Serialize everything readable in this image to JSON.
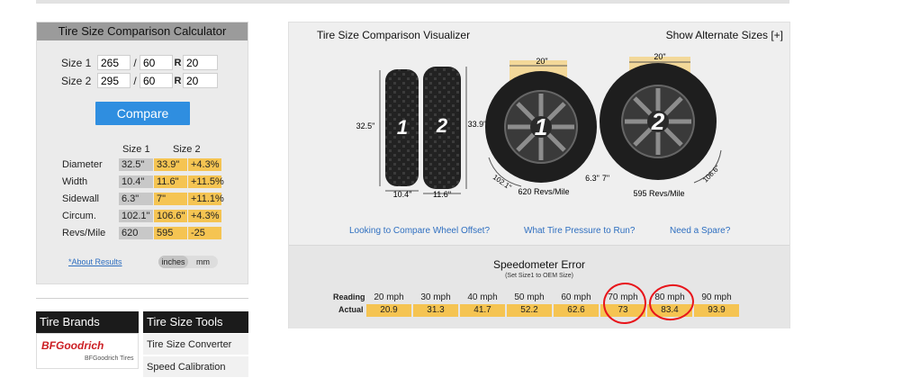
{
  "calculator": {
    "title": "Tire Size Comparison Calculator",
    "size1": {
      "label": "Size 1",
      "width": "265",
      "ratio": "60",
      "rim": "20"
    },
    "size2": {
      "label": "Size 2",
      "width": "295",
      "ratio": "60",
      "rim": "20"
    },
    "slash": "/",
    "rim_prefix": "R",
    "compare_label": "Compare",
    "col_size1": "Size 1",
    "col_size2": "Size 2",
    "rows": [
      {
        "label": "Diameter",
        "s1": "32.5\"",
        "s2": "33.9\"",
        "diff": "+4.3%"
      },
      {
        "label": "Width",
        "s1": "10.4\"",
        "s2": "11.6\"",
        "diff": "+11.5%"
      },
      {
        "label": "Sidewall",
        "s1": "6.3\"",
        "s2": "7\"",
        "diff": "+11.1%"
      },
      {
        "label": "Circum.",
        "s1": "102.1\"",
        "s2": "106.6\"",
        "diff": "+4.3%"
      },
      {
        "label": "Revs/Mile",
        "s1": "620",
        "s2": "595",
        "diff": "-25"
      }
    ],
    "about_link": "*About Results",
    "unit_inches": "inches",
    "unit_mm": "mm"
  },
  "brands": {
    "title": "Tire Brands",
    "logo_text": "BFGoodrich",
    "logo_sub": "BFGoodrich Tires"
  },
  "tools": {
    "title": "Tire Size Tools",
    "items": [
      "Tire Size Converter",
      "Speed Calibration"
    ]
  },
  "visualizer": {
    "title": "Tire Size Comparison Visualizer",
    "alt_link": "Show Alternate Sizes [+]",
    "tread1_height": "32.5\"",
    "tread2_height": "33.9\"",
    "tread1_width": "10.4\"",
    "tread2_width": "11.6\"",
    "tire1_number": "1",
    "tire2_number": "2",
    "wheel1_rim": "20\"",
    "wheel2_rim": "20\"",
    "wheel1_circ": "102.1\"",
    "wheel2_circ": "106.6\"",
    "sidewall1": "6.3\"",
    "sidewall2": "7\"",
    "wheel1_revs": "620 Revs/Mile",
    "wheel2_revs": "595 Revs/Mile",
    "links": [
      "Looking to Compare Wheel Offset?",
      "What Tire Pressure to Run?",
      "Need a Spare?"
    ]
  },
  "speedometer": {
    "title": "Speedometer Error",
    "subtitle": "(Set Size1 to OEM Size)",
    "reading_label": "Reading",
    "actual_label": "Actual",
    "readings": [
      "20 mph",
      "30 mph",
      "40 mph",
      "50 mph",
      "60 mph",
      "70 mph",
      "80 mph",
      "90 mph"
    ],
    "actuals": [
      "20.9",
      "31.3",
      "41.7",
      "52.2",
      "62.6",
      "73",
      "83.4",
      "93.9"
    ],
    "highlight_color": "#e8151b"
  },
  "colors": {
    "accent_blue": "#2f8ee0",
    "highlight_orange": "#f5c452",
    "neutral_gray": "#c8c8c8"
  }
}
